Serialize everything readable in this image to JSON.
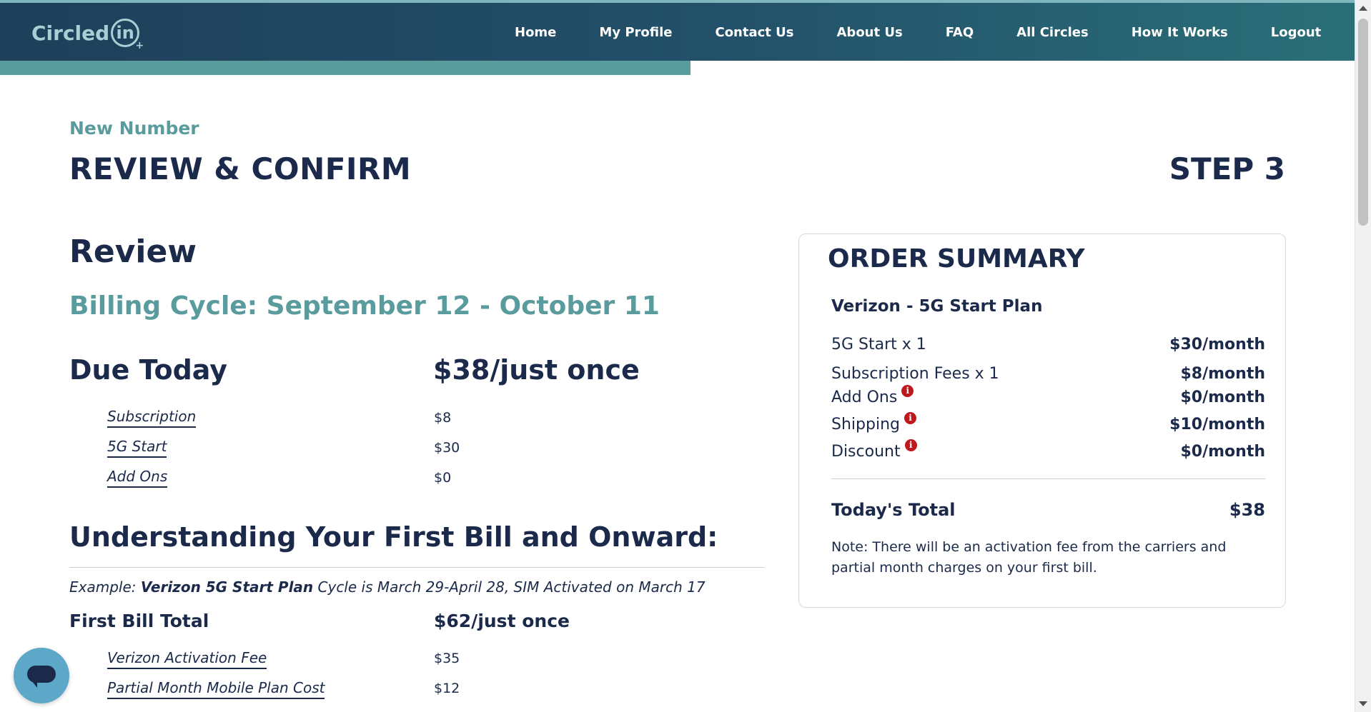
{
  "nav": {
    "logo_text": "Circled",
    "logo_circle_text": "in",
    "items": [
      "Home",
      "My Profile",
      "Contact Us",
      "About Us",
      "FAQ",
      "All Circles",
      "How It Works",
      "Logout"
    ],
    "progress_fraction": 0.51
  },
  "header": {
    "subtitle": "New Number",
    "title": "REVIEW & CONFIRM",
    "step": "STEP 3"
  },
  "review": {
    "heading": "Review",
    "billing_cycle": "Billing Cycle: September 12 - October 11",
    "due_today_label": "Due Today",
    "due_today_value": "$38/just once",
    "lines": [
      {
        "label": "Subscription",
        "value": "$8"
      },
      {
        "label": "5G Start",
        "value": "$30"
      },
      {
        "label": "Add Ons",
        "value": "$0"
      }
    ]
  },
  "first_bill": {
    "heading": "Understanding Your First Bill and Onward:",
    "example_prefix": "Example: ",
    "example_plan": "Verizon 5G Start Plan",
    "example_suffix": " Cycle is March 29-April 28, SIM Activated on March 17",
    "total_label": "First Bill Total",
    "total_value": "$62/just once",
    "lines": [
      {
        "label": "Verizon Activation Fee",
        "value": "$35"
      },
      {
        "label": "Partial Month Mobile Plan Cost",
        "value": "$12"
      }
    ]
  },
  "summary": {
    "title": "ORDER SUMMARY",
    "plan_name": "Verizon - 5G Start Plan",
    "rows": [
      {
        "label": "5G Start x 1",
        "value": "$30/month",
        "info": false
      },
      {
        "label": "Subscription Fees x 1",
        "value": "$8/month",
        "info": false
      },
      {
        "label": "Add Ons",
        "value": "$0/month",
        "info": true
      },
      {
        "label": "Shipping",
        "value": "$10/month",
        "info": true
      },
      {
        "label": "Discount",
        "value": "$0/month",
        "info": true
      }
    ],
    "total_label": "Today's Total",
    "total_value": "$38",
    "note": "Note: There will be an activation fee from the carriers and partial month charges on your first bill.",
    "info_icon_glyph": "i"
  },
  "colors": {
    "accent_teal": "#5a9c9d",
    "navy": "#1b2a4a",
    "info_red": "#c0171c",
    "chat_blue": "#5da8c8"
  },
  "icons": {
    "info": "info-icon",
    "chat": "chat-bubble-icon"
  }
}
